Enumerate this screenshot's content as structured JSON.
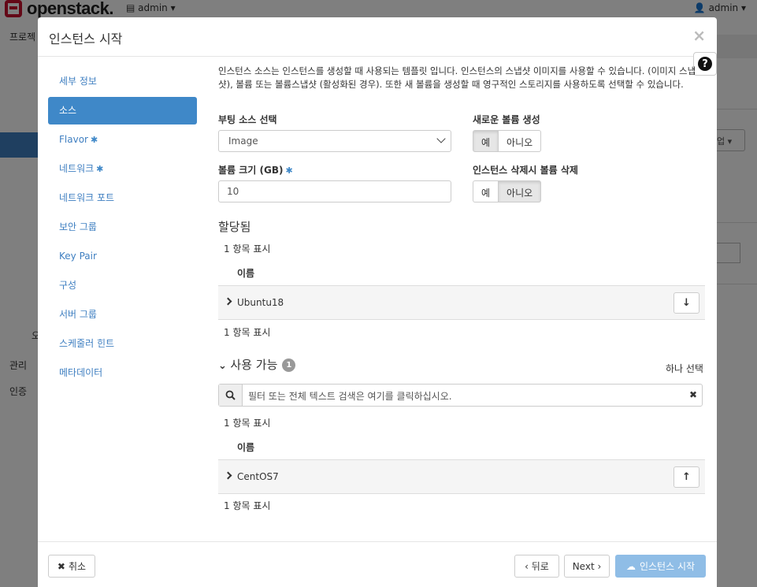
{
  "topbar": {
    "brand": "openstack.",
    "project": "admin ▾",
    "user": "admin ▾"
  },
  "background": {
    "project_label": "프로젝",
    "label_admin": "관리",
    "label_identity": "인증",
    "label_partial": "오",
    "right_button": "업 ▾"
  },
  "modal": {
    "title": "인스턴스 시작",
    "close": "×",
    "help": "?"
  },
  "sidebar": {
    "items": [
      {
        "label": "세부 정보",
        "required": ""
      },
      {
        "label": "소스",
        "required": ""
      },
      {
        "label": "Flavor",
        "required": "✱"
      },
      {
        "label": "네트워크",
        "required": "✱"
      },
      {
        "label": "네트워크 포트",
        "required": ""
      },
      {
        "label": "보안 그룹",
        "required": ""
      },
      {
        "label": "Key Pair",
        "required": ""
      },
      {
        "label": "구성",
        "required": ""
      },
      {
        "label": "서버 그룹",
        "required": ""
      },
      {
        "label": "스케줄러 힌트",
        "required": ""
      },
      {
        "label": "메타데이터",
        "required": ""
      }
    ]
  },
  "source": {
    "description": "인스턴스 소스는 인스턴스를 생성할 때 사용되는 템플릿 입니다. 인스턴스의 스냅샷 이미지를 사용할 수 있습니다. (이미지 스냅샷), 볼륨 또는 볼륨스냅샷 (활성화된 경우). 또한 새 볼륨을 생성할 때 영구적인 스토리지를 사용하도록 선택할 수 있습니다.",
    "boot_source_label": "부팅 소스 선택",
    "boot_source_value": "Image",
    "new_volume_label": "새로운 볼륨 생성",
    "new_volume_yes": "예",
    "new_volume_no": "아니오",
    "volume_size_label": "볼륨 크기 (GB)",
    "volume_size_required": "✱",
    "volume_size_value": "10",
    "delete_volume_label": "인스턴스 삭제시 볼륨 삭제",
    "delete_volume_yes": "예",
    "delete_volume_no": "아니오"
  },
  "allocated": {
    "title": "할당됨",
    "count_top": "1 항목 표시",
    "column_name": "이름",
    "rows": [
      {
        "name": "Ubuntu18"
      }
    ],
    "count_bottom": "1 항목 표시"
  },
  "available": {
    "title": "사용 가능",
    "badge": "1",
    "select_one": "하나 선택",
    "search_placeholder": "필터 또는 전체 텍스트 검색은 여기를 클릭하십시오.",
    "count_top": "1 항목 표시",
    "column_name": "이름",
    "rows": [
      {
        "name": "CentOS7"
      }
    ],
    "count_bottom": "1 항목 표시"
  },
  "footer": {
    "cancel": "취소",
    "back": "‹ 뒤로",
    "next": "Next ›",
    "launch": "인스턴스 시작"
  }
}
